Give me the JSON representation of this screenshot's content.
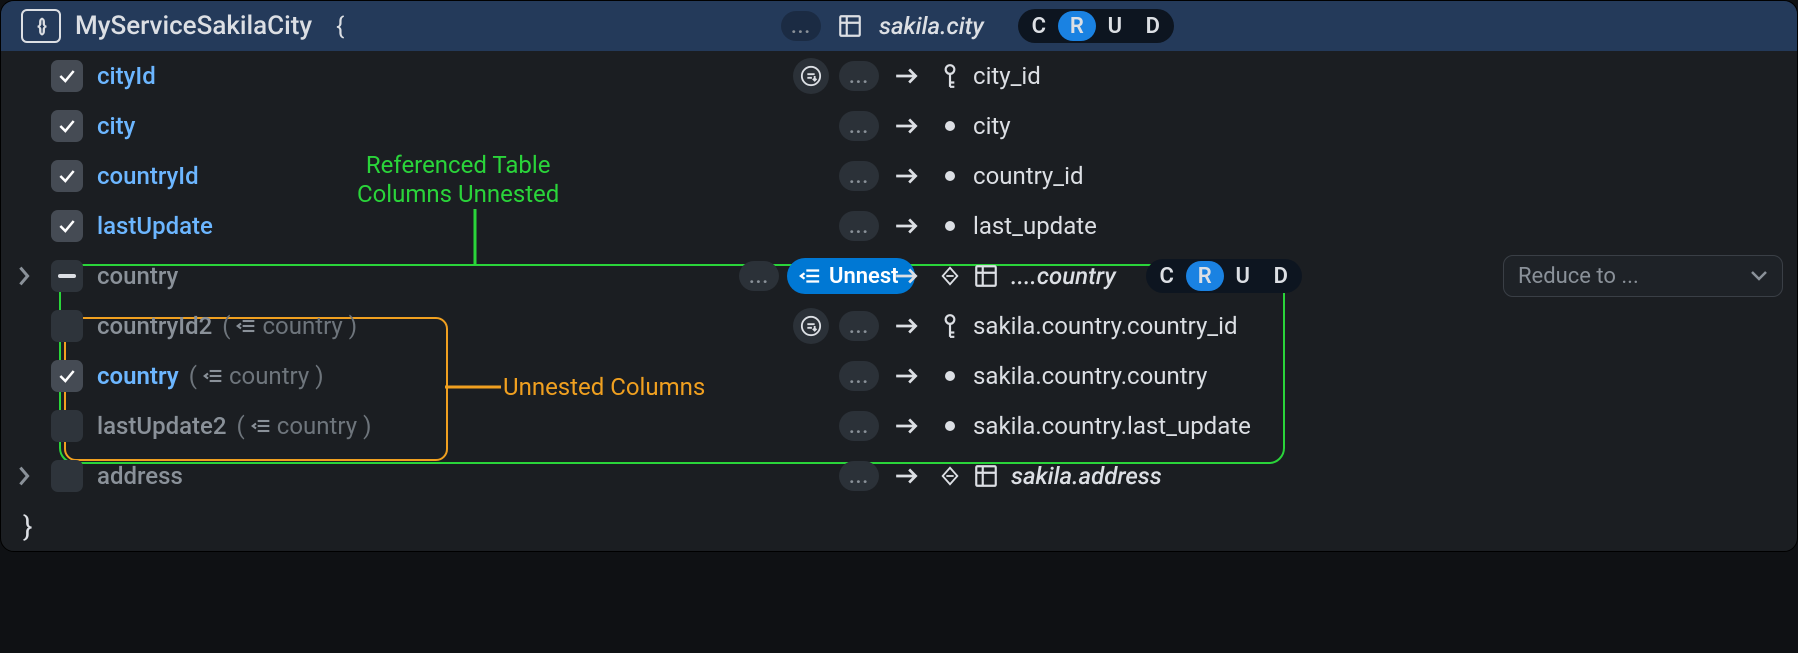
{
  "header": {
    "title": "MyServiceSakilaCity",
    "brace_open": "{",
    "brace_close": "}",
    "table": "sakila.city",
    "crud": {
      "c": "C",
      "r": "R",
      "u": "U",
      "d": "D",
      "active": "R"
    }
  },
  "annotations": {
    "green_label": "Referenced Table\nColumns Unnested",
    "orange_label": "Unnested Columns"
  },
  "unnest_button": "Unnest",
  "reduce_placeholder": "Reduce to ...",
  "dots": "...",
  "fields": [
    {
      "name": "cityId",
      "checked": true,
      "style": "blue",
      "sort": true,
      "key": true,
      "maps": "city_id"
    },
    {
      "name": "city",
      "checked": true,
      "style": "blue",
      "sort": false,
      "key": false,
      "maps": "city"
    },
    {
      "name": "countryId",
      "checked": true,
      "style": "blue",
      "sort": false,
      "key": false,
      "maps": "country_id"
    },
    {
      "name": "lastUpdate",
      "checked": true,
      "style": "blue",
      "sort": false,
      "key": false,
      "maps": "last_update"
    }
  ],
  "country": {
    "label": "country",
    "table": "....country",
    "crud": {
      "c": "C",
      "r": "R",
      "u": "U",
      "d": "D",
      "active": "R"
    },
    "children": [
      {
        "name": "countryId2",
        "from": "country",
        "checked": false,
        "sort": true,
        "key": true,
        "maps": "sakila.country.country_id"
      },
      {
        "name": "country",
        "from": "country",
        "checked": true,
        "sort": false,
        "key": false,
        "maps": "sakila.country.country",
        "highlight": true
      },
      {
        "name": "lastUpdate2",
        "from": "country",
        "checked": false,
        "sort": false,
        "key": false,
        "maps": "sakila.country.last_update"
      }
    ]
  },
  "address": {
    "label": "address",
    "table": "sakila.address"
  }
}
